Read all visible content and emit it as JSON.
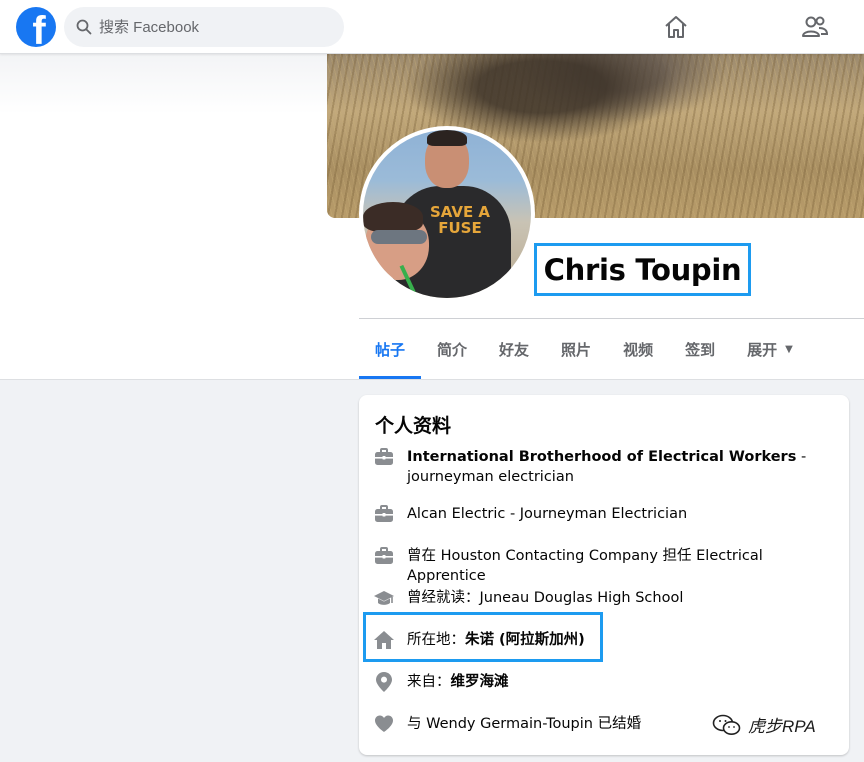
{
  "topbar": {
    "logo_letter": "f",
    "search_placeholder": "搜索 Facebook"
  },
  "profile": {
    "name": "Chris Toupin",
    "avatar_shirt_text": "SAVE A FUSE"
  },
  "tabs": [
    {
      "label": "帖子",
      "active": true
    },
    {
      "label": "简介"
    },
    {
      "label": "好友"
    },
    {
      "label": "照片"
    },
    {
      "label": "视频"
    },
    {
      "label": "签到"
    },
    {
      "label": "展开"
    }
  ],
  "intro": {
    "title": "个人资料",
    "items": [
      {
        "icon": "briefcase-icon",
        "text": "International Brotherhood of Electrical Workers",
        "suffix": " - journeyman electrician"
      },
      {
        "icon": "briefcase-icon",
        "text": "Alcan Electric - Journeyman Electrician"
      },
      {
        "icon": "briefcase-icon",
        "text": "曾在 Houston Contacting Company 担任 Electrical Apprentice"
      },
      {
        "icon": "graduation-cap-icon",
        "prefix": "曾经就读：",
        "text": "Juneau Douglas High School"
      },
      {
        "icon": "home-icon",
        "prefix": "所在地：",
        "text": "朱诺 (阿拉斯加州)"
      },
      {
        "icon": "location-pin-icon",
        "prefix": "来自：",
        "text": "维罗海滩"
      },
      {
        "icon": "heart-icon",
        "prefix": "与 ",
        "text": "Wendy Germain-Toupin",
        "suffix": " 已结婚"
      }
    ]
  },
  "watermark": "虎步RPA",
  "colors": {
    "brand": "#1877f2",
    "highlight": "#1d9bf0",
    "icon": "#65676b"
  }
}
